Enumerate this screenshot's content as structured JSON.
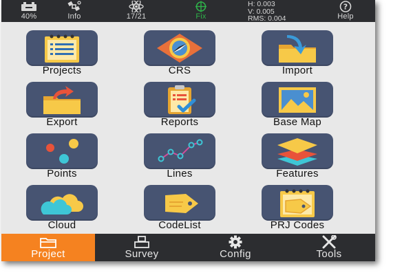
{
  "status_bar": {
    "battery": {
      "icon": "car-battery-icon",
      "label": "40%"
    },
    "info": {
      "icon": "satellite-info-icon",
      "label": "Info"
    },
    "satellites": {
      "icon": "atom-satellites-icon",
      "label": "17/21"
    },
    "fix": {
      "icon": "crosshair-fix-icon",
      "label": "Fix",
      "color": "#2fb24a"
    },
    "precision": {
      "h": "H: 0.003",
      "v": "V: 0.005",
      "rms": "RMS: 0.004"
    },
    "help": {
      "icon": "question-mark-icon",
      "label": "Help"
    }
  },
  "tiles": [
    {
      "label": "Projects",
      "icon": "projects-notepad-icon"
    },
    {
      "label": "CRS",
      "icon": "crs-compass-icon"
    },
    {
      "label": "Import",
      "icon": "import-folder-icon"
    },
    {
      "label": "Export",
      "icon": "export-folder-icon"
    },
    {
      "label": "Reports",
      "icon": "reports-clipboard-icon"
    },
    {
      "label": "Base Map",
      "icon": "base-map-image-icon"
    },
    {
      "label": "Points",
      "icon": "points-dots-icon"
    },
    {
      "label": "Lines",
      "icon": "lines-polyline-icon"
    },
    {
      "label": "Features",
      "icon": "features-layers-icon"
    },
    {
      "label": "Cloud",
      "icon": "cloud-icon"
    },
    {
      "label": "CodeList",
      "icon": "codelist-tag-icon"
    },
    {
      "label": "PRJ Codes",
      "icon": "prj-codes-tag-icon"
    }
  ],
  "bottom_nav": {
    "active": "Project",
    "tabs": [
      {
        "label": "Project",
        "icon": "folder-icon"
      },
      {
        "label": "Survey",
        "icon": "survey-instrument-icon"
      },
      {
        "label": "Config",
        "icon": "gear-icon"
      },
      {
        "label": "Tools",
        "icon": "tools-wrench-screwdriver-icon"
      }
    ]
  },
  "colors": {
    "bar_background": "#2c2d30",
    "tile_background": "#475472",
    "page_background": "#e8e8e8",
    "accent_active": "#f58220",
    "fix_green": "#2fb24a"
  }
}
